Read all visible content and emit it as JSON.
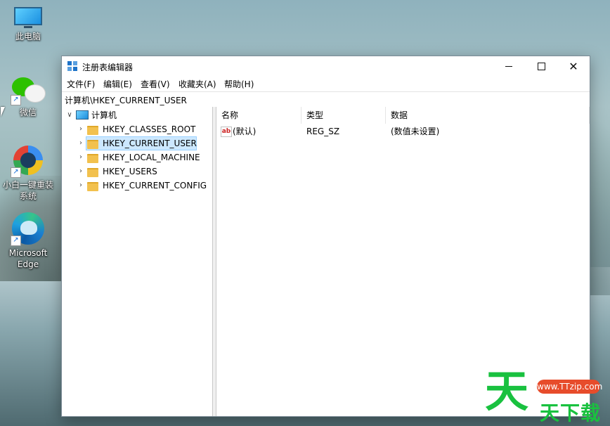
{
  "desktop": {
    "icons": [
      {
        "label": "此电脑"
      },
      {
        "label": "微信"
      },
      {
        "label": "小白一键重装系统"
      },
      {
        "label": "Microsoft Edge"
      }
    ]
  },
  "window": {
    "title": "注册表编辑器",
    "controls": {
      "minimize": "minimize",
      "maximize": "maximize",
      "close": "✕"
    },
    "menu": [
      "文件(F)",
      "编辑(E)",
      "查看(V)",
      "收藏夹(A)",
      "帮助(H)"
    ],
    "address": "计算机\\HKEY_CURRENT_USER",
    "tree": {
      "root": "计算机",
      "keys": [
        "HKEY_CLASSES_ROOT",
        "HKEY_CURRENT_USER",
        "HKEY_LOCAL_MACHINE",
        "HKEY_USERS",
        "HKEY_CURRENT_CONFIG"
      ],
      "selected": "HKEY_CURRENT_USER"
    },
    "list": {
      "columns": [
        "名称",
        "类型",
        "数据"
      ],
      "rows": [
        {
          "name": "(默认)",
          "type": "REG_SZ",
          "data": "(数值未设置)"
        }
      ]
    }
  },
  "watermark": {
    "big": "天",
    "url": "www.TTzip.com",
    "text": "天下载"
  }
}
